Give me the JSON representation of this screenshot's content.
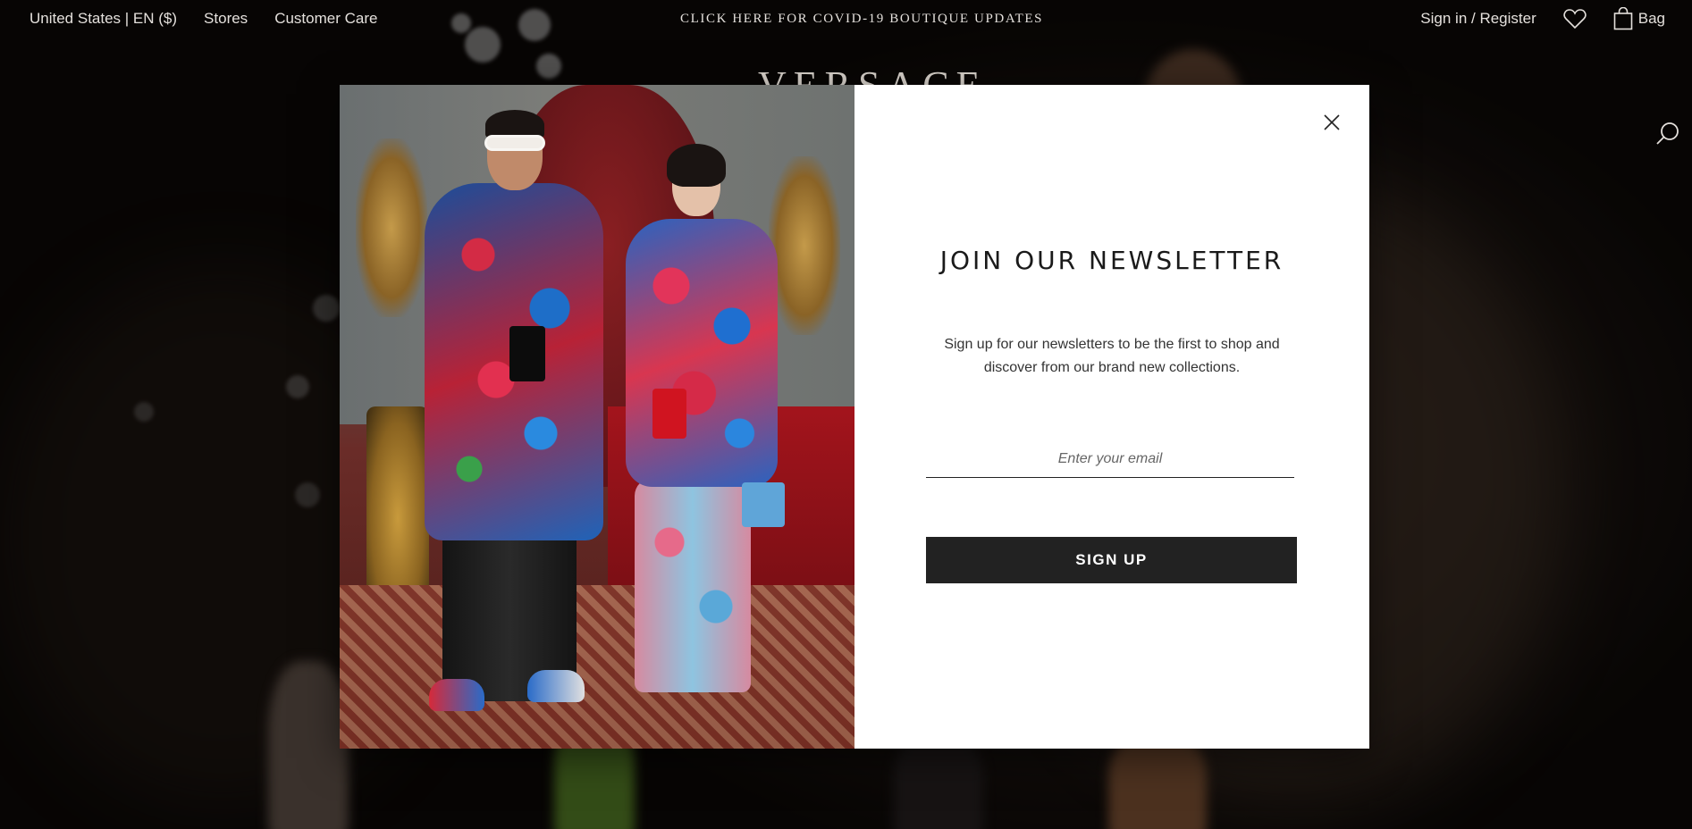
{
  "topnav": {
    "locale": "United States | EN ($)",
    "stores": "Stores",
    "customer_care": "Customer Care",
    "covid_banner": "CLICK HERE FOR COVID-19 BOUTIQUE UPDATES",
    "sign_in": "Sign in / Register",
    "wishlist_icon": "heart-icon",
    "bag_icon": "shopping-bag-icon",
    "bag_label": "Bag"
  },
  "brand": {
    "logo_text": "VERSACE"
  },
  "search": {
    "icon": "search-icon"
  },
  "newsletter_modal": {
    "close_icon": "close-icon",
    "title": "JOIN OUR NEWSLETTER",
    "description": "Sign up for our newsletters to be the first to shop and discover from our brand new collections.",
    "email_placeholder": "Enter your email",
    "email_value": "",
    "submit_label": "SIGN UP"
  },
  "colors": {
    "modal_bg": "#ffffff",
    "button_bg": "#222222",
    "button_text": "#ffffff",
    "nav_text": "#e4e0dc"
  }
}
